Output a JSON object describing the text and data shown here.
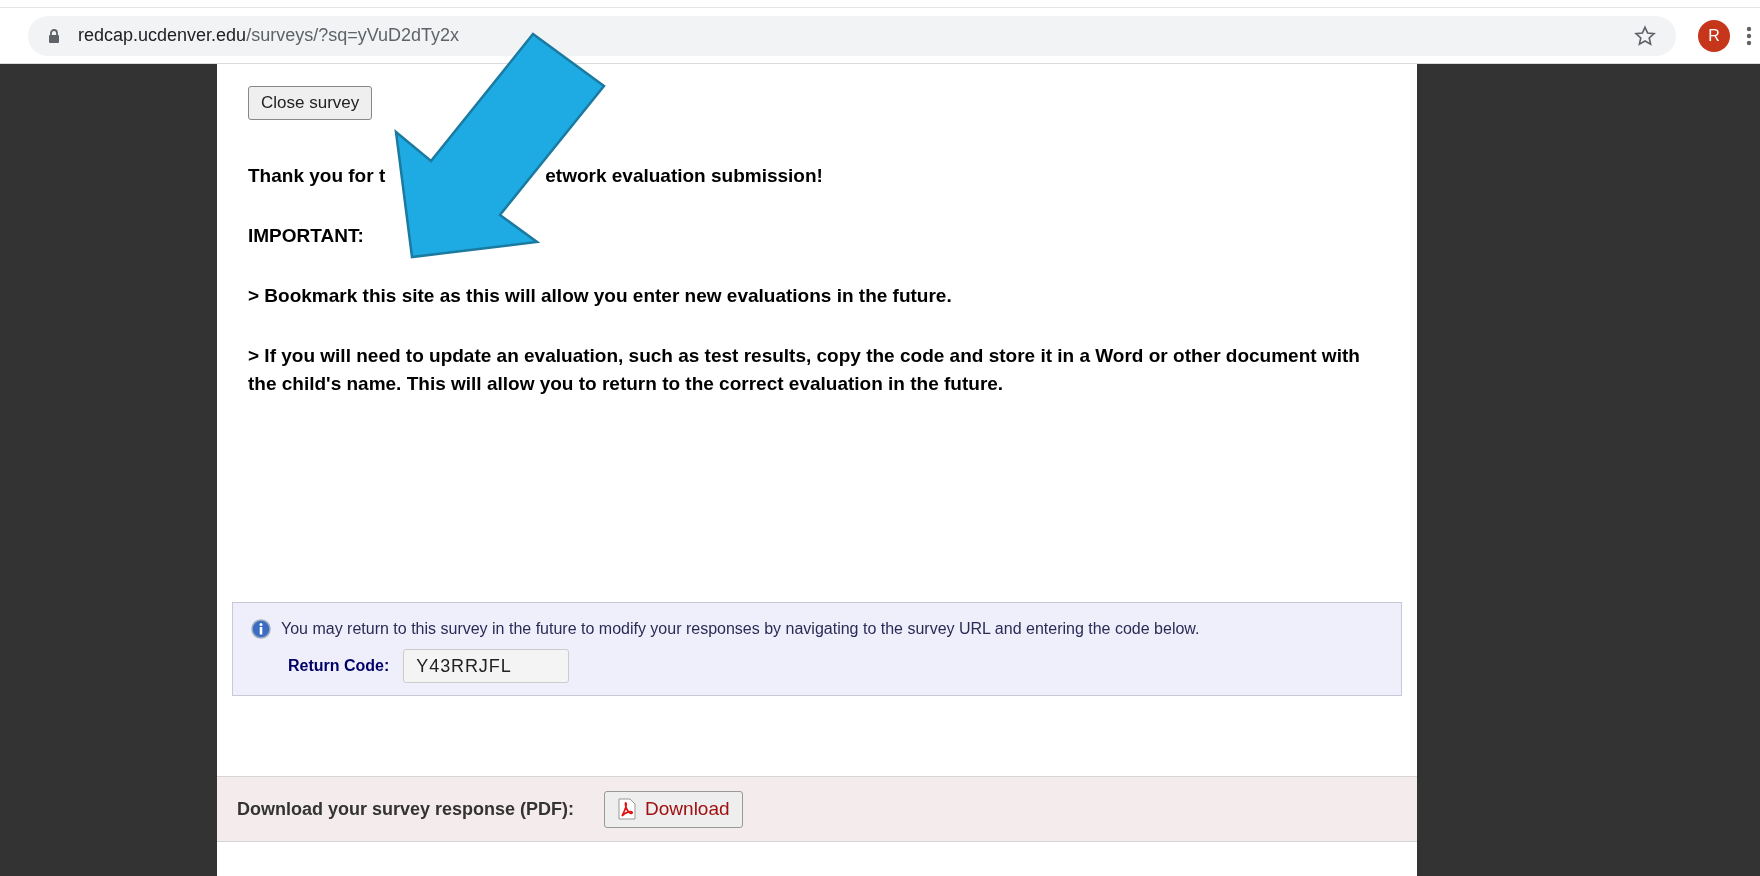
{
  "browser": {
    "url_host": "redcap.ucdenver.edu",
    "url_path": "/surveys/?sq=yVuD2dTy2x",
    "avatar_letter": "R"
  },
  "close_button": "Close survey",
  "thank_you": [
    "Thank you for t",
    "etwork evaluation submission!"
  ],
  "messages": [
    "IMPORTANT:",
    "> Bookmark this site as this will allow you enter new evaluations in the future.",
    "> If you will need to update an evaluation, such as test results, copy the code and store it in a Word or other document with the child's name. This will allow you to return to the correct evaluation in the future."
  ],
  "return_info": {
    "text": "You may return to this survey in the future to modify your responses by navigating to the survey URL and entering the code below.",
    "label": "Return Code:",
    "code": "Y43RRJFL"
  },
  "download": {
    "label": "Download your survey response (PDF):",
    "button": "Download"
  }
}
